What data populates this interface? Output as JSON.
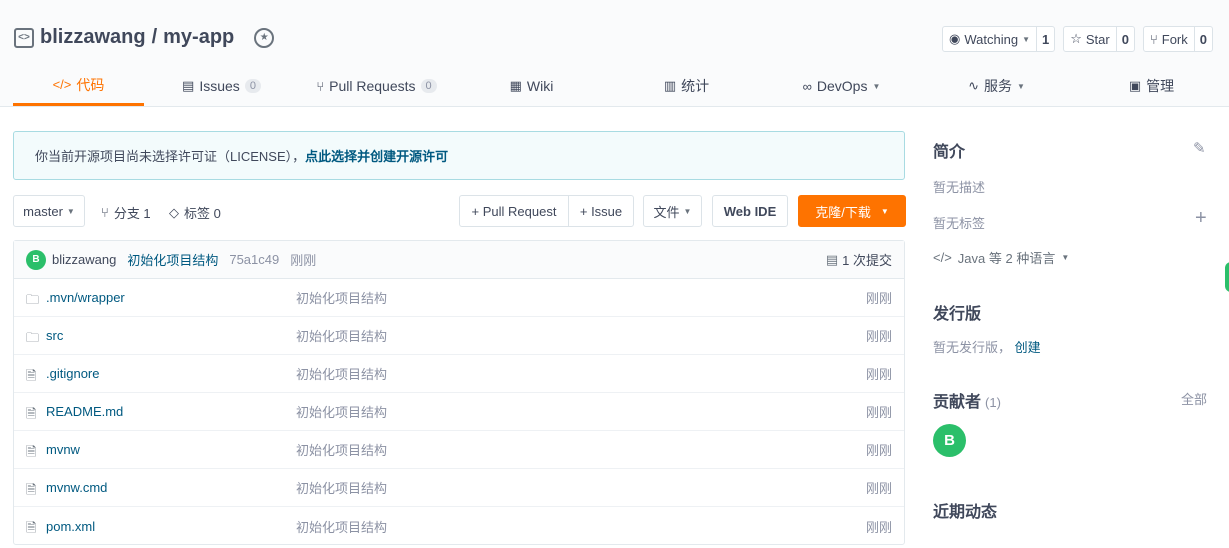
{
  "repo": {
    "owner": "blizzawang",
    "separator": "/",
    "name": "my-app"
  },
  "actions": {
    "watch": {
      "label": "Watching",
      "count": "1"
    },
    "star": {
      "label": "Star",
      "count": "0"
    },
    "fork": {
      "label": "Fork",
      "count": "0"
    }
  },
  "tabs": [
    {
      "label": "代码",
      "icon": "code-icon"
    },
    {
      "label": "Issues",
      "badge": "0",
      "icon": "issues-icon"
    },
    {
      "label": "Pull Requests",
      "badge": "0",
      "icon": "pull-request-icon"
    },
    {
      "label": "Wiki",
      "icon": "wiki-icon"
    },
    {
      "label": "统计",
      "icon": "stats-icon"
    },
    {
      "label": "DevOps",
      "icon": "devops-icon"
    },
    {
      "label": "服务",
      "icon": "service-icon"
    },
    {
      "label": "管理",
      "icon": "manage-icon"
    }
  ],
  "notice": {
    "text": "你当前开源项目尚未选择许可证（LICENSE），",
    "link": "点此选择并创建开源许可"
  },
  "toolbar": {
    "branch": "master",
    "branches": "分支 1",
    "tags": "标签 0",
    "pull_request": "+ Pull Request",
    "issue": "+ Issue",
    "file": "文件",
    "webide": "Web IDE",
    "clone": "克隆/下载"
  },
  "commit": {
    "avatar": "B",
    "author": "blizzawang",
    "message": "初始化项目结构",
    "hash": "75a1c49",
    "time": "刚刚",
    "count": "1 次提交"
  },
  "files": [
    {
      "name": ".mvn/wrapper",
      "type": "folder",
      "message": "初始化项目结构",
      "time": "刚刚"
    },
    {
      "name": "src",
      "type": "folder",
      "message": "初始化项目结构",
      "time": "刚刚"
    },
    {
      "name": ".gitignore",
      "type": "file",
      "message": "初始化项目结构",
      "time": "刚刚"
    },
    {
      "name": "README.md",
      "type": "file",
      "message": "初始化项目结构",
      "time": "刚刚"
    },
    {
      "name": "mvnw",
      "type": "file",
      "message": "初始化项目结构",
      "time": "刚刚"
    },
    {
      "name": "mvnw.cmd",
      "type": "file",
      "message": "初始化项目结构",
      "time": "刚刚"
    },
    {
      "name": "pom.xml",
      "type": "file",
      "message": "初始化项目结构",
      "time": "刚刚"
    }
  ],
  "sidebar": {
    "intro_title": "简介",
    "no_desc": "暂无描述",
    "no_tags": "暂无标签",
    "languages": "Java 等 2 种语言",
    "release_title": "发行版",
    "no_release": "暂无发行版，",
    "create": "创建",
    "contrib_title": "贡献者",
    "contrib_count": "(1)",
    "all": "全部",
    "contrib_avatar": "B",
    "activity_title": "近期动态"
  },
  "colors": {
    "accent": "#fe7300",
    "link": "#005980",
    "avatar": "#2bbf6a"
  }
}
